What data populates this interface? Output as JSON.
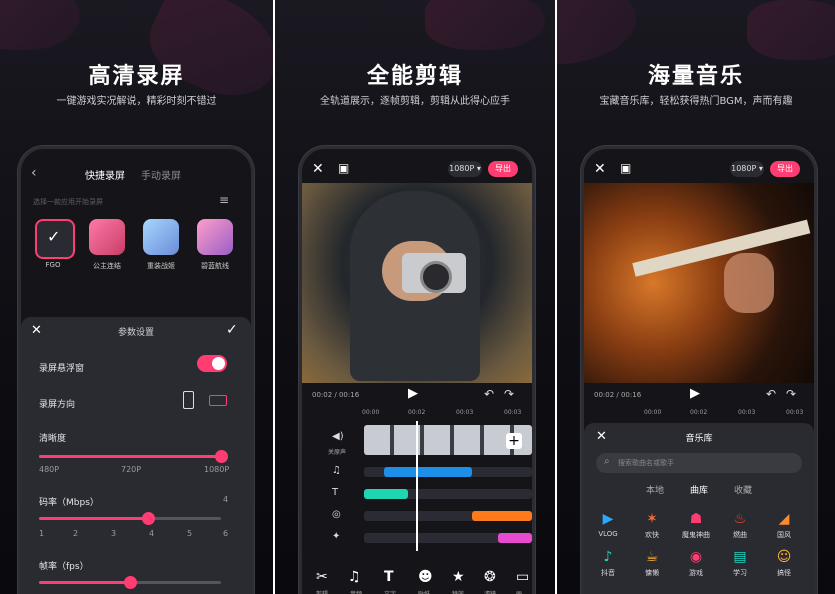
{
  "panel1": {
    "headline": "高清录屏",
    "subline": "一键游戏实况解说，精彩时刻不错过",
    "tabs": [
      "快捷录屏",
      "手动录屏"
    ],
    "hint": "选择一款应用开始录屏",
    "apps": [
      "FGO",
      "公主连结",
      "重装战姬",
      "碧蓝航线"
    ],
    "sheet_title": "参数设置",
    "floating_label": "录屏悬浮窗",
    "orientation_label": "录屏方向",
    "clarity_label": "清晰度",
    "clarity_ticks": [
      "480P",
      "720P",
      "1080P"
    ],
    "clarity_value": 1.0,
    "bitrate_label": "码率（Mbps）",
    "bitrate_ticks": [
      "1",
      "2",
      "3",
      "4",
      "5",
      "6"
    ],
    "bitrate_top_value": "4",
    "bitrate_value": 0.6,
    "fps_label": "帧率（fps）",
    "fps_value": 0.5
  },
  "panel2": {
    "headline": "全能剪辑",
    "subline": "全轨道展示，逐帧剪辑，剪辑从此得心应手",
    "resolution": "1080P",
    "export": "导出",
    "time": "00:02 / 00:16",
    "ruler": [
      "00:00",
      "00:02",
      "00:03",
      "00:03"
    ],
    "audio_label": "关原声",
    "tools": [
      "剪辑",
      "音频",
      "文字",
      "贴纸",
      "特效",
      "滤镜",
      "画"
    ]
  },
  "panel3": {
    "headline": "海量音乐",
    "subline": "宝藏音乐库，轻松获得热门BGM，声而有趣",
    "resolution": "1080P",
    "export": "导出",
    "time": "00:02 / 00:16",
    "ruler": [
      "00:00",
      "00:02",
      "00:03",
      "00:03"
    ],
    "library_title": "音乐库",
    "search_placeholder": "搜索歌曲名或歌手",
    "tabs": [
      "本地",
      "曲库",
      "收藏"
    ],
    "categories": [
      {
        "label": "VLOG",
        "icon": "video-icon",
        "color": "#2aa7ff"
      },
      {
        "label": "欢快",
        "icon": "party-icon",
        "color": "#ff6b3d"
      },
      {
        "label": "魔鬼神曲",
        "icon": "rocket-icon",
        "color": "#ff3d73"
      },
      {
        "label": "燃曲",
        "icon": "flame-icon",
        "color": "#ff4a2b"
      },
      {
        "label": "国风",
        "icon": "fan-icon",
        "color": "#ff8a2b"
      },
      {
        "label": "抖音",
        "icon": "note-icon",
        "color": "#1ed6c4"
      },
      {
        "label": "慵懒",
        "icon": "cup-icon",
        "color": "#ffb62b"
      },
      {
        "label": "游戏",
        "icon": "gamepad-icon",
        "color": "#ff3d73"
      },
      {
        "label": "学习",
        "icon": "book-icon",
        "color": "#1ed6c4"
      },
      {
        "label": "搞怪",
        "icon": "emoji-icon",
        "color": "#ffb62b"
      }
    ]
  }
}
